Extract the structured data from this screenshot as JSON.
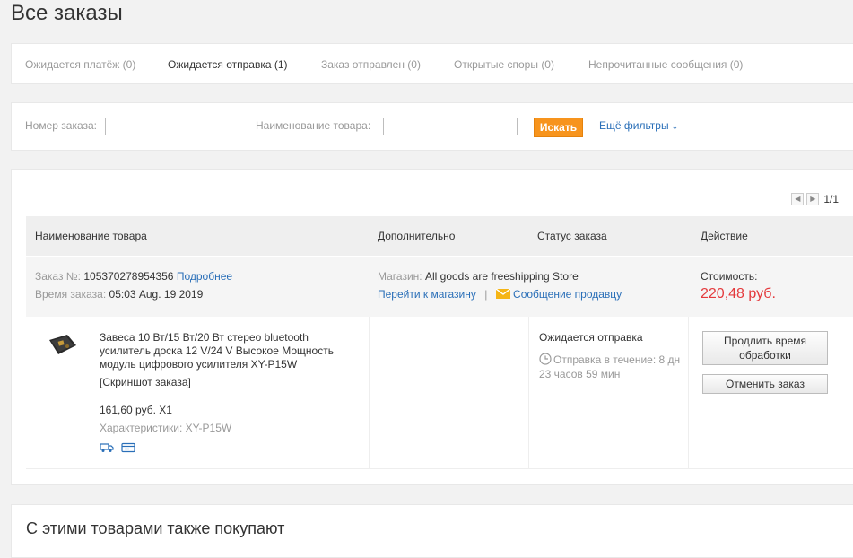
{
  "page": {
    "title": "Все заказы"
  },
  "tabs": [
    {
      "label": "Ожидается платёж (0)"
    },
    {
      "label": "Ожидается отправка (1)"
    },
    {
      "label": "Заказ отправлен (0)"
    },
    {
      "label": "Открытые споры (0)"
    },
    {
      "label": "Непрочитанные сообщения (0)"
    }
  ],
  "filters": {
    "order_number_label": "Номер заказа:",
    "order_number_value": "",
    "product_name_label": "Наименование товара:",
    "product_name_value": "",
    "search_label": "Искать",
    "more_filters_label": "Ещё фильтры"
  },
  "pager": {
    "text": "1/1"
  },
  "table": {
    "headers": [
      "Наименование товара",
      "Дополнительно",
      "Статус заказа",
      "Действие"
    ]
  },
  "order": {
    "number_label": "Заказ №:",
    "number": "105370278954356",
    "details_link": "Подробнее",
    "time_label": "Время заказа:",
    "time": "05:03 Aug. 19 2019",
    "store_label": "Магазин:",
    "store": "All goods are freeshipping Store",
    "go_to_store": "Перейти к магазину",
    "separator": "|",
    "message_seller": "Сообщение продавцу",
    "cost_label": "Стоимость:",
    "cost": "220,48 руб.",
    "product_title": "Завеса 10 Вт/15 Вт/20 Вт стерео bluetooth усилитель доска 12 V/24 V Высокое Мощность модуль цифрового усилителя XY-P15W",
    "snapshot": "[Скриншот заказа]",
    "unit_price": "161,60 руб. X1",
    "props": "Характеристики: XY-P15W",
    "status": "Ожидается отправка",
    "countdown": "Отправка в течение: 8 дн 23 часов 59 мин",
    "extend_label": "Продлить время обработки",
    "cancel_label": "Отменить заказ"
  },
  "also_buy": {
    "title": "С этими товарами также покупают"
  },
  "colors": {
    "accent": "#f7941d",
    "link": "#2a6fb8",
    "price": "#e4393c"
  },
  "icons": [
    "chevron-down-icon",
    "prev-page-icon",
    "next-page-icon",
    "mail-icon",
    "clock-icon",
    "delivery-truck-icon",
    "payment-card-icon"
  ]
}
